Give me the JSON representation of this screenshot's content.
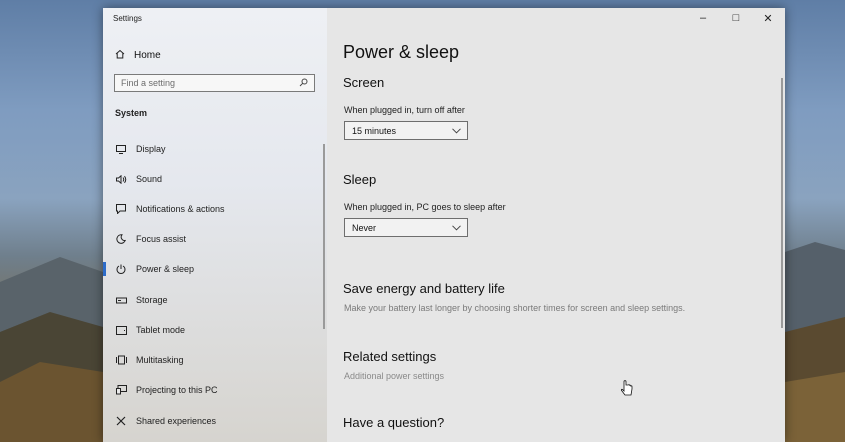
{
  "window": {
    "title": "Settings"
  },
  "window_controls": {
    "minimize": "–",
    "maximize": "□",
    "close": "✕"
  },
  "sidebar": {
    "home_label": "Home",
    "search_placeholder": "Find a setting",
    "section_label": "System",
    "items": [
      {
        "label": "Display",
        "icon": "monitor-icon"
      },
      {
        "label": "Sound",
        "icon": "speaker-icon"
      },
      {
        "label": "Notifications & actions",
        "icon": "notifications-icon"
      },
      {
        "label": "Focus assist",
        "icon": "moon-icon"
      },
      {
        "label": "Power & sleep",
        "icon": "power-icon",
        "active": true
      },
      {
        "label": "Storage",
        "icon": "storage-icon"
      },
      {
        "label": "Tablet mode",
        "icon": "tablet-icon"
      },
      {
        "label": "Multitasking",
        "icon": "multitasking-icon"
      },
      {
        "label": "Projecting to this PC",
        "icon": "projector-icon"
      },
      {
        "label": "Shared experiences",
        "icon": "shared-icon"
      }
    ]
  },
  "main": {
    "title": "Power & sleep",
    "screen": {
      "heading": "Screen",
      "label": "When plugged in, turn off after",
      "value": "15 minutes"
    },
    "sleep": {
      "heading": "Sleep",
      "label": "When plugged in, PC goes to sleep after",
      "value": "Never"
    },
    "save_energy": {
      "heading": "Save energy and battery life",
      "desc": "Make your battery last longer by choosing shorter times for screen and sleep settings."
    },
    "related": {
      "heading": "Related settings",
      "link": "Additional power settings"
    },
    "question": {
      "heading": "Have a question?"
    }
  },
  "colors": {
    "accent": "#2d6cc9",
    "window_bg": "#e6e6e6",
    "sidebar_bg": "#eef0f4"
  }
}
